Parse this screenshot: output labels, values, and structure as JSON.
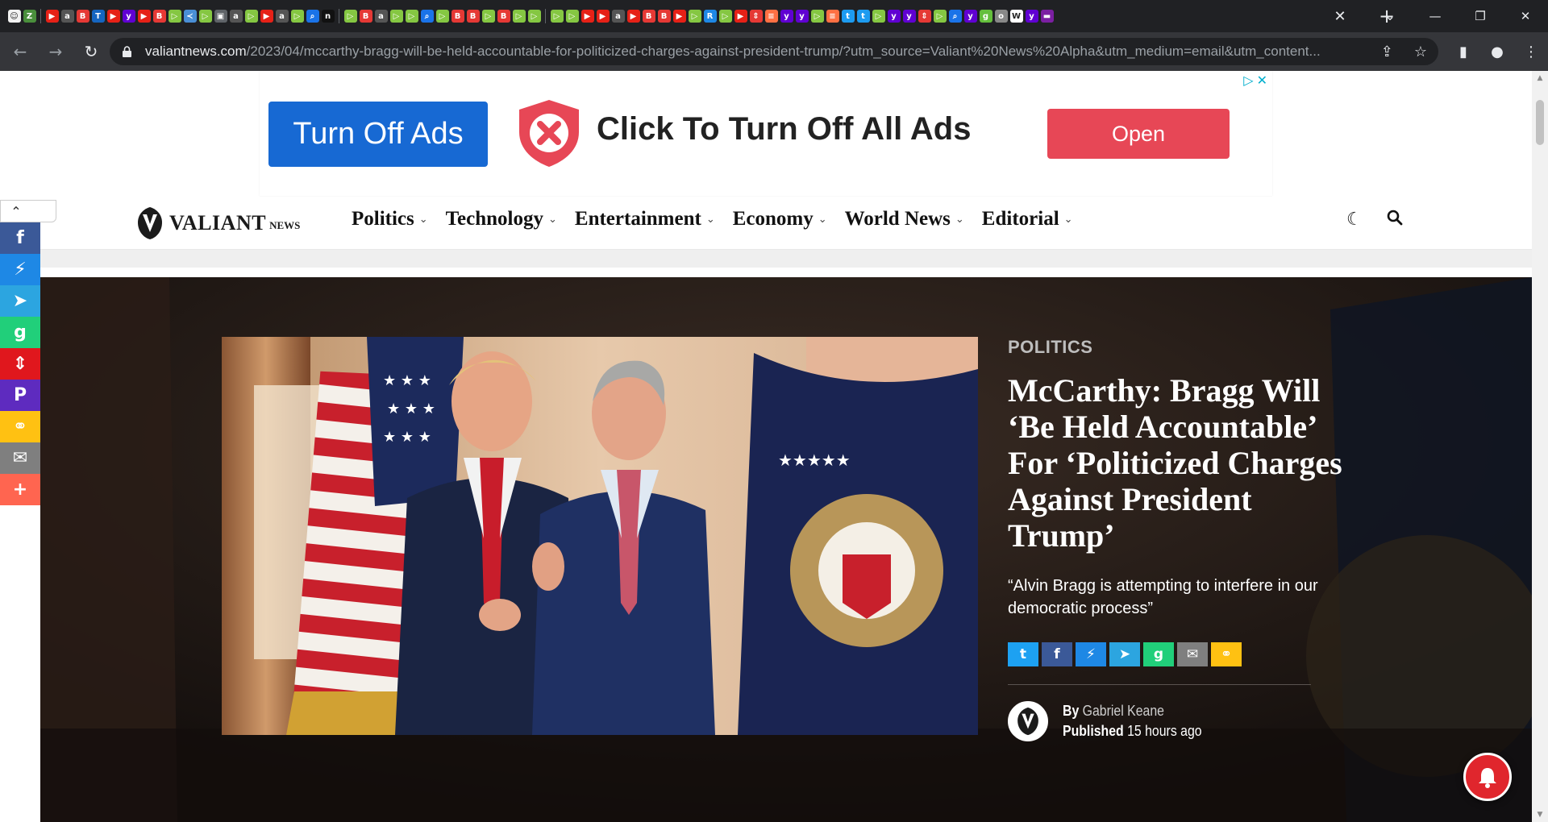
{
  "browser": {
    "tabs_favicons": [
      {
        "icon": "grinning-face-icon",
        "color": "#f2f2f2",
        "glyph": "☺"
      },
      {
        "icon": "zh-icon",
        "color": "#4a8f3c",
        "glyph": "Z"
      },
      {
        "icon": "youtube-icon",
        "color": "#e62117",
        "glyph": "▶"
      },
      {
        "icon": "ap-icon",
        "color": "#555",
        "glyph": "a"
      },
      {
        "icon": "b-icon",
        "color": "#e53935",
        "glyph": "B"
      },
      {
        "icon": "t-icon",
        "color": "#1565c0",
        "glyph": "T"
      },
      {
        "icon": "youtube-icon",
        "color": "#e62117",
        "glyph": "▶"
      },
      {
        "icon": "yahoo-icon",
        "color": "#6001d2",
        "glyph": "y"
      },
      {
        "icon": "youtube-icon",
        "color": "#e62117",
        "glyph": "▶"
      },
      {
        "icon": "b-icon",
        "color": "#e53935",
        "glyph": "B"
      },
      {
        "icon": "rumble-icon",
        "color": "#85c742",
        "glyph": "▷"
      },
      {
        "icon": "ap-icon",
        "color": "#4a8fd6",
        "glyph": "≺"
      },
      {
        "icon": "rumble-icon",
        "color": "#85c742",
        "glyph": "▷"
      },
      {
        "icon": "doc-icon",
        "color": "#5f6368",
        "glyph": "▣"
      },
      {
        "icon": "ap-icon",
        "color": "#555",
        "glyph": "a"
      },
      {
        "icon": "rumble-icon",
        "color": "#85c742",
        "glyph": "▷"
      },
      {
        "icon": "youtube-icon",
        "color": "#e62117",
        "glyph": "▶"
      },
      {
        "icon": "ap-icon",
        "color": "#555",
        "glyph": "a"
      },
      {
        "icon": "rumble-icon",
        "color": "#85c742",
        "glyph": "▷"
      },
      {
        "icon": "search-icon",
        "color": "#1a73e8",
        "glyph": "⌕"
      },
      {
        "icon": "n-icon",
        "color": "#111",
        "glyph": "n"
      },
      {
        "icon": "rumble-icon",
        "color": "#85c742",
        "glyph": "▷"
      },
      {
        "icon": "b-icon",
        "color": "#e53935",
        "glyph": "B"
      },
      {
        "icon": "ap-icon",
        "color": "#555",
        "glyph": "a"
      },
      {
        "icon": "rumble-icon",
        "color": "#85c742",
        "glyph": "▷"
      },
      {
        "icon": "rumble-icon",
        "color": "#85c742",
        "glyph": "▷"
      },
      {
        "icon": "search-icon",
        "color": "#1a73e8",
        "glyph": "⌕"
      },
      {
        "icon": "rumble-icon",
        "color": "#85c742",
        "glyph": "▷"
      },
      {
        "icon": "b-icon",
        "color": "#e53935",
        "glyph": "B"
      },
      {
        "icon": "b-icon",
        "color": "#e53935",
        "glyph": "B"
      },
      {
        "icon": "rumble-icon",
        "color": "#85c742",
        "glyph": "▷"
      },
      {
        "icon": "b-icon",
        "color": "#e53935",
        "glyph": "B"
      },
      {
        "icon": "rumble-icon",
        "color": "#85c742",
        "glyph": "▷"
      },
      {
        "icon": "rumble-icon",
        "color": "#85c742",
        "glyph": "▷"
      },
      {
        "icon": "rumble-icon",
        "color": "#85c742",
        "glyph": "▷"
      },
      {
        "icon": "rumble-icon",
        "color": "#85c742",
        "glyph": "▷"
      },
      {
        "icon": "youtube-icon",
        "color": "#e62117",
        "glyph": "▶"
      },
      {
        "icon": "youtube-icon",
        "color": "#e62117",
        "glyph": "▶"
      },
      {
        "icon": "ap-icon",
        "color": "#555",
        "glyph": "a"
      },
      {
        "icon": "youtube-icon",
        "color": "#e62117",
        "glyph": "▶"
      },
      {
        "icon": "b-icon",
        "color": "#e53935",
        "glyph": "B"
      },
      {
        "icon": "b-icon",
        "color": "#e53935",
        "glyph": "B"
      },
      {
        "icon": "youtube-icon",
        "color": "#e62117",
        "glyph": "▶"
      },
      {
        "icon": "rumble-icon",
        "color": "#85c742",
        "glyph": "▷"
      },
      {
        "icon": "r-icon",
        "color": "#1e88e5",
        "glyph": "R"
      },
      {
        "icon": "rumble-icon",
        "color": "#85c742",
        "glyph": "▷"
      },
      {
        "icon": "youtube-icon",
        "color": "#e62117",
        "glyph": "▶"
      },
      {
        "icon": "gettr-icon",
        "color": "#e53935",
        "glyph": "⇕"
      },
      {
        "icon": "flag-icon",
        "color": "#ff7043",
        "glyph": "≡"
      },
      {
        "icon": "yahoo-icon",
        "color": "#6001d2",
        "glyph": "y"
      },
      {
        "icon": "yahoo-icon",
        "color": "#6001d2",
        "glyph": "y"
      },
      {
        "icon": "rumble-icon",
        "color": "#85c742",
        "glyph": "▷"
      },
      {
        "icon": "flag-icon",
        "color": "#ff7043",
        "glyph": "≡"
      },
      {
        "icon": "twitter-icon",
        "color": "#1d9bf0",
        "glyph": "t"
      },
      {
        "icon": "twitter-icon",
        "color": "#1d9bf0",
        "glyph": "t"
      },
      {
        "icon": "rumble-icon",
        "color": "#85c742",
        "glyph": "▷"
      },
      {
        "icon": "yahoo-icon",
        "color": "#6001d2",
        "glyph": "y"
      },
      {
        "icon": "yahoo-icon",
        "color": "#6001d2",
        "glyph": "y"
      },
      {
        "icon": "gettr-icon",
        "color": "#e53935",
        "glyph": "⇕"
      },
      {
        "icon": "rumble-icon",
        "color": "#85c742",
        "glyph": "▷"
      },
      {
        "icon": "search-icon",
        "color": "#1a73e8",
        "glyph": "⌕"
      },
      {
        "icon": "yahoo-icon",
        "color": "#6001d2",
        "glyph": "y"
      },
      {
        "icon": "g-icon",
        "color": "#64bf3c",
        "glyph": "g"
      },
      {
        "icon": "o-icon",
        "color": "#888",
        "glyph": "o"
      },
      {
        "icon": "w-icon",
        "color": "#fff",
        "glyph": "W"
      },
      {
        "icon": "yahoo-icon",
        "color": "#6001d2",
        "glyph": "y"
      },
      {
        "icon": "purple-icon",
        "color": "#7b1fa2",
        "glyph": "▬"
      }
    ],
    "url_host": "valiantnews.com",
    "url_path": "/2023/04/mccarthy-bragg-will-be-held-accountable-for-politicized-charges-against-president-trump/?utm_source=Valiant%20News%20Alpha&utm_medium=email&utm_content..."
  },
  "ad": {
    "turn_off_label": "Turn Off Ads",
    "headline": "Click To Turn Off All Ads",
    "open_label": "Open",
    "colors": {
      "blue": "#1769d3",
      "red": "#e74756",
      "shield": "#e74756"
    }
  },
  "site": {
    "logo_text": "VALIANT",
    "logo_news": "NEWS",
    "menu": [
      {
        "label": "Politics"
      },
      {
        "label": "Technology"
      },
      {
        "label": "Entertainment"
      },
      {
        "label": "Economy"
      },
      {
        "label": "World News"
      },
      {
        "label": "Editorial"
      }
    ]
  },
  "sidebar_share": [
    {
      "name": "facebook",
      "icon": "facebook-icon",
      "color": "#3b5998",
      "glyph": "f"
    },
    {
      "name": "messenger",
      "icon": "messenger-icon",
      "color": "#1e88e5",
      "glyph": "⚡"
    },
    {
      "name": "telegram",
      "icon": "telegram-icon",
      "color": "#2ca5e0",
      "glyph": "➤"
    },
    {
      "name": "gab",
      "icon": "gab-icon",
      "color": "#21cf7a",
      "glyph": "g"
    },
    {
      "name": "gettr",
      "icon": "gettr-icon",
      "color": "#e0171d",
      "glyph": "⇕"
    },
    {
      "name": "parler",
      "icon": "parler-icon",
      "color": "#5e2bbf",
      "glyph": "P"
    },
    {
      "name": "copy",
      "icon": "copy-link-icon",
      "color": "#ffc112",
      "glyph": "⚭"
    },
    {
      "name": "email",
      "icon": "email-icon",
      "color": "#7f7f7f",
      "glyph": "✉"
    },
    {
      "name": "more",
      "icon": "more-icon",
      "color": "#ff6550",
      "glyph": "+"
    }
  ],
  "article": {
    "category": "POLITICS",
    "headline": "McCarthy: Bragg Will ‘Be Held Accountable’ For ‘Politicized Charges Against President Trump’",
    "subhead": "“Alvin Bragg is attempting to interfere in our democratic process”",
    "by_label": "By",
    "author": "Gabriel Keane",
    "published_label": "Published",
    "published_time": "15 hours ago"
  },
  "article_share": [
    {
      "icon": "twitter-icon",
      "color": "#1da1f2",
      "glyph": "t"
    },
    {
      "icon": "facebook-icon",
      "color": "#3b5998",
      "glyph": "f"
    },
    {
      "icon": "messenger-icon",
      "color": "#1e88e5",
      "glyph": "⚡"
    },
    {
      "icon": "telegram-icon",
      "color": "#2ca5e0",
      "glyph": "➤"
    },
    {
      "icon": "gab-icon",
      "color": "#21cf7a",
      "glyph": "g"
    },
    {
      "icon": "email-icon",
      "color": "#7f7f7f",
      "glyph": "✉"
    },
    {
      "icon": "copy-link-icon",
      "color": "#ffc112",
      "glyph": "⚭"
    }
  ]
}
